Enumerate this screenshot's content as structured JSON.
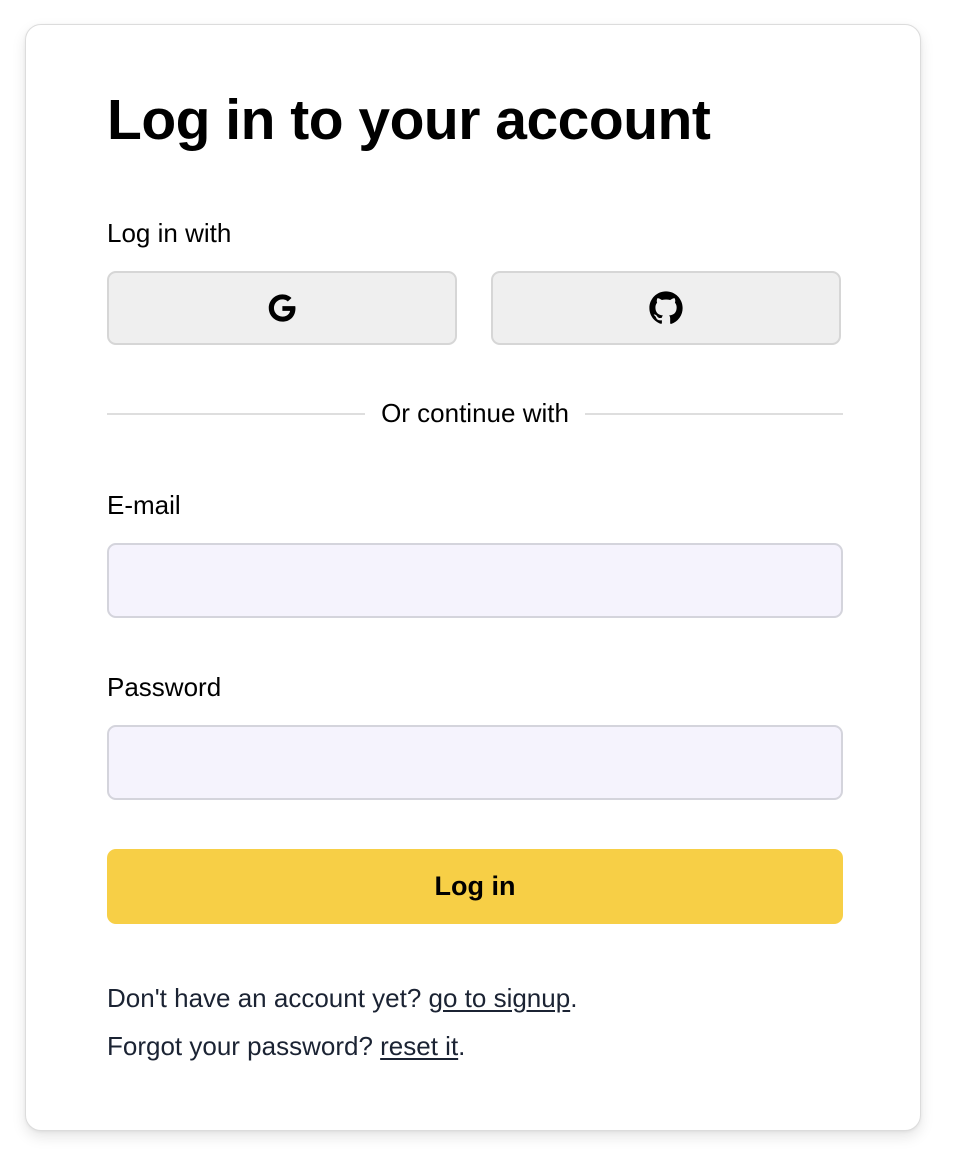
{
  "card": {
    "title": "Log in to your account",
    "oauth": {
      "label": "Log in with",
      "providers": [
        {
          "icon": "google-icon"
        },
        {
          "icon": "github-icon"
        }
      ]
    },
    "divider_text": "Or continue with",
    "email": {
      "label": "E-mail",
      "value": "",
      "placeholder": ""
    },
    "password": {
      "label": "Password",
      "value": "",
      "placeholder": ""
    },
    "submit_label": "Log in",
    "signup": {
      "prefix": "Don't have an account yet? ",
      "link": "go to signup",
      "suffix": "."
    },
    "reset": {
      "prefix": "Forgot your password? ",
      "link": "reset it",
      "suffix": "."
    }
  },
  "colors": {
    "accent": "#f7cf46",
    "input_bg": "#f5f3fd",
    "oauth_bg": "#efefef",
    "text_dark": "#1b2333"
  }
}
